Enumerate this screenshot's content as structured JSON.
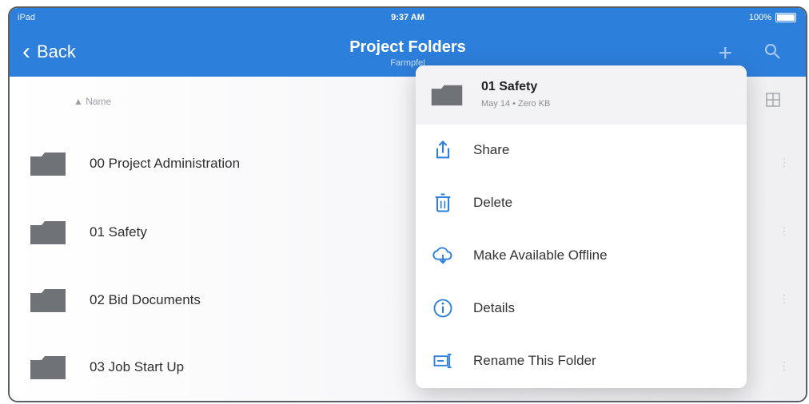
{
  "status": {
    "left": "iPad",
    "time": "9:37 AM",
    "battery": "100%"
  },
  "nav": {
    "back_label": "Back",
    "title": "Project Folders",
    "subtitle": "Farmpfel"
  },
  "list": {
    "sort_label": "Name",
    "items": [
      {
        "label": "00 Project Administration"
      },
      {
        "label": "01 Safety"
      },
      {
        "label": "02 Bid Documents"
      },
      {
        "label": "03 Job Start Up"
      }
    ]
  },
  "popup": {
    "header": {
      "name": "01 Safety",
      "meta": "May 14 • Zero KB"
    },
    "items": [
      {
        "label": "Share",
        "icon": "share-icon"
      },
      {
        "label": "Delete",
        "icon": "trash-icon"
      },
      {
        "label": "Make Available Offline",
        "icon": "cloud-download-icon"
      },
      {
        "label": "Details",
        "icon": "info-icon"
      },
      {
        "label": "Rename This Folder",
        "icon": "rename-icon"
      }
    ]
  },
  "colors": {
    "accent": "#2d7fdc",
    "folder": "#6f7377",
    "icon_blue": "#2d7fdc"
  }
}
